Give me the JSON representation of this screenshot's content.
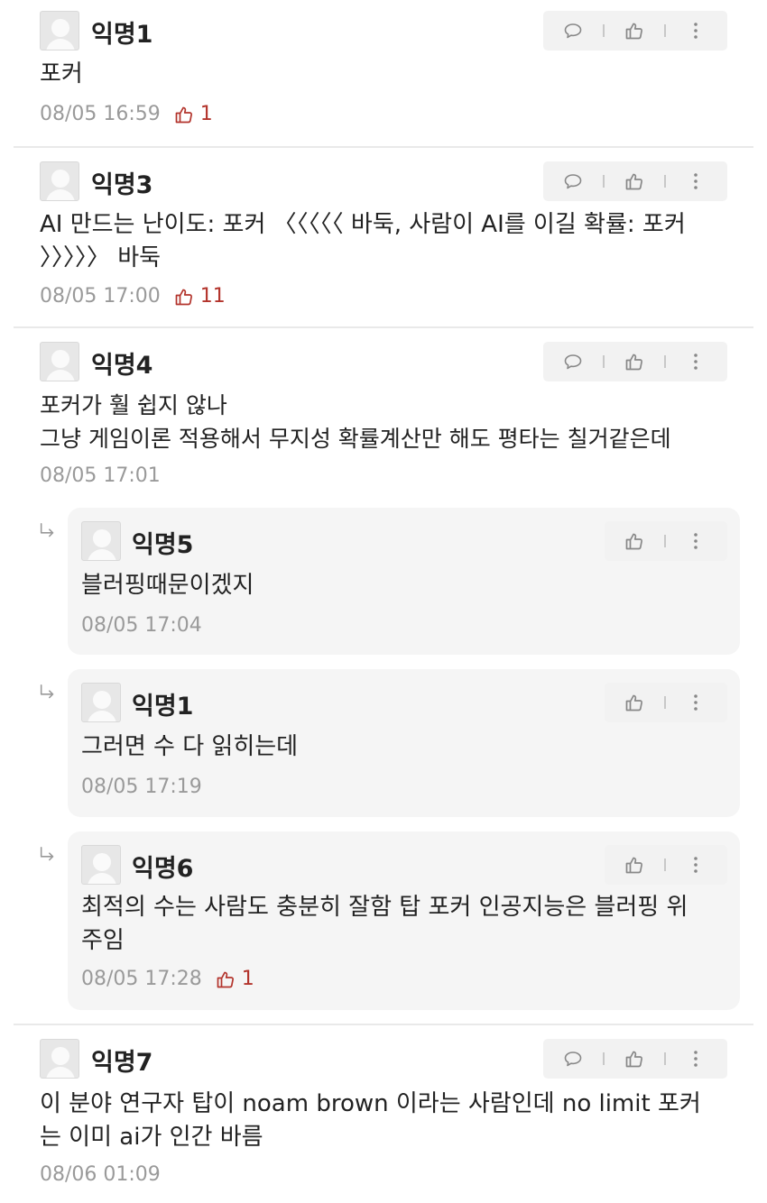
{
  "comments": [
    {
      "nick": "익명1",
      "text": "포커",
      "time": "08/05 16:59",
      "likes": "1"
    },
    {
      "nick": "익명3",
      "text": "AI 만드는 난이도: 포커 〈〈〈〈〈 바둑, 사람이 AI를 이길 확률: 포커\n〉〉〉〉〉 바둑",
      "time": "08/05 17:00",
      "likes": "11"
    },
    {
      "nick": "익명4",
      "text": "포커가 훨 쉽지 않나\n그냥 게임이론 적용해서 무지성 확률계산만 해도 평타는 칠거같은데",
      "time": "08/05 17:01"
    },
    {
      "nick": "익명7",
      "text": "이 분야 연구자 탑이 noam brown 이라는 사람인데 no limit 포커\n는 이미 ai가 인간 바름",
      "time": "08/06 01:09"
    }
  ],
  "replies": [
    {
      "nick": "익명5",
      "text": "블러핑때문이겠지",
      "time": "08/05 17:04"
    },
    {
      "nick": "익명1",
      "text": "그러면 수 다 읽히는데",
      "time": "08/05 17:19"
    },
    {
      "nick": "익명6",
      "text": "최적의 수는 사람도 충분히 잘함 탑 포커 인공지능은 블러핑 위\n주임",
      "time": "08/05 17:28",
      "likes": "1"
    }
  ],
  "icons": {
    "comment": "speech-bubble-icon",
    "like": "thumbs-up-icon",
    "more": "more-vertical-icon",
    "avatar": "anonymous-avatar-icon",
    "reply": "reply-arrow-icon"
  },
  "colors": {
    "like": "#b3342c",
    "meta": "#9a9a9a",
    "toolbar": "#f2f2f2",
    "reply_bg": "#f5f5f5"
  }
}
